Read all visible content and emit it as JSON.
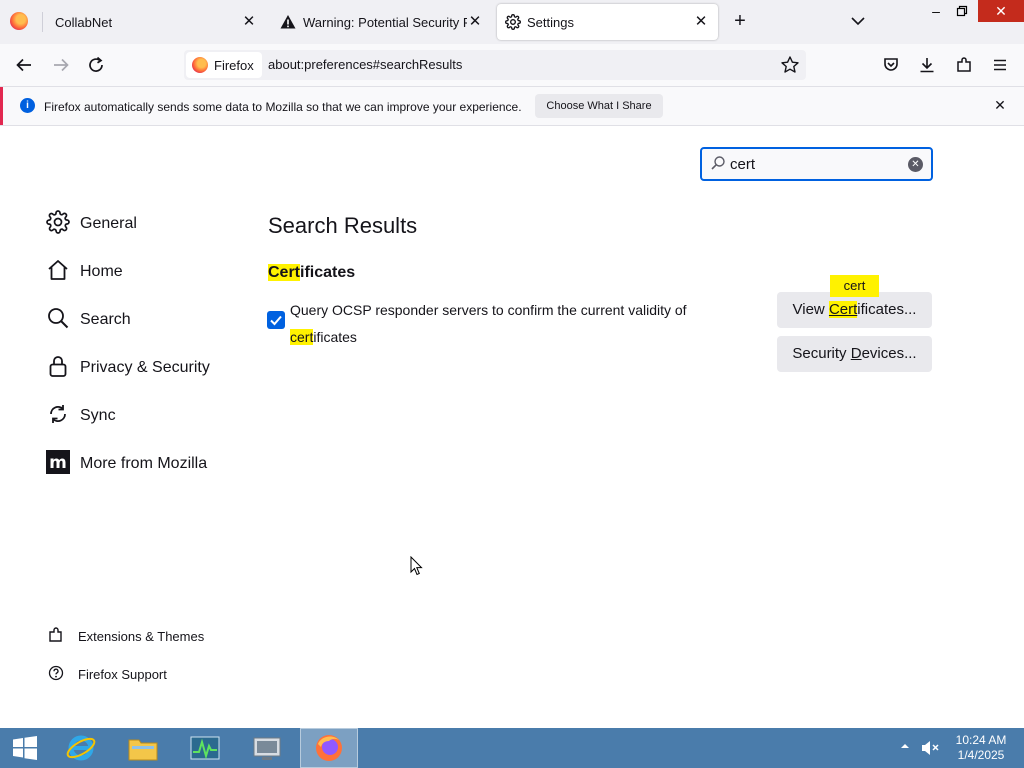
{
  "browser": {
    "tabs": [
      {
        "label": "CollabNet",
        "icon": "firefox-logo-icon"
      },
      {
        "label": "Warning: Potential Security Risk",
        "icon": "warning-icon"
      },
      {
        "label": "Settings",
        "icon": "gear-icon",
        "active": true
      }
    ],
    "identity_label": "Firefox",
    "url": "about:preferences#searchResults"
  },
  "notification": {
    "message": "Firefox automatically sends some data to Mozilla so that we can improve your experience.",
    "action_label": "Choose What I Share"
  },
  "settings": {
    "search_value": "cert",
    "categories": [
      {
        "label": "General",
        "icon": "gear-icon"
      },
      {
        "label": "Home",
        "icon": "home-icon"
      },
      {
        "label": "Search",
        "icon": "search-icon"
      },
      {
        "label": "Privacy & Security",
        "icon": "lock-icon"
      },
      {
        "label": "Sync",
        "icon": "sync-icon"
      },
      {
        "label": "More from Mozilla",
        "icon": "mozilla-icon"
      }
    ],
    "footer_links": [
      {
        "label": "Extensions & Themes",
        "icon": "puzzle-icon"
      },
      {
        "label": "Firefox Support",
        "icon": "help-icon"
      }
    ],
    "results_title": "Search Results",
    "certificates": {
      "heading_match": "Cert",
      "heading_rest": "ificates",
      "ocsp_checked": true,
      "ocsp_text_before": "Query OCSP responder servers to confirm the current validity of ",
      "ocsp_text_match": "cert",
      "ocsp_text_after": "ificates",
      "view_button": {
        "before": "View ",
        "match": "Cert",
        "after": "ificates..."
      },
      "devices_button": {
        "before": "Security ",
        "underline": "D",
        "after": "evices..."
      },
      "match_tooltip": "cert"
    }
  },
  "taskbar": {
    "apps": [
      "internet-explorer-icon",
      "file-explorer-icon",
      "task-manager-icon",
      "server-manager-icon",
      "firefox-icon"
    ],
    "time": "10:24 AM",
    "date": "1/4/2025"
  },
  "colors": {
    "highlight": "#fff200",
    "accent": "#0061e0",
    "taskbar": "#4a7cab",
    "close_button": "#c42b1c"
  }
}
